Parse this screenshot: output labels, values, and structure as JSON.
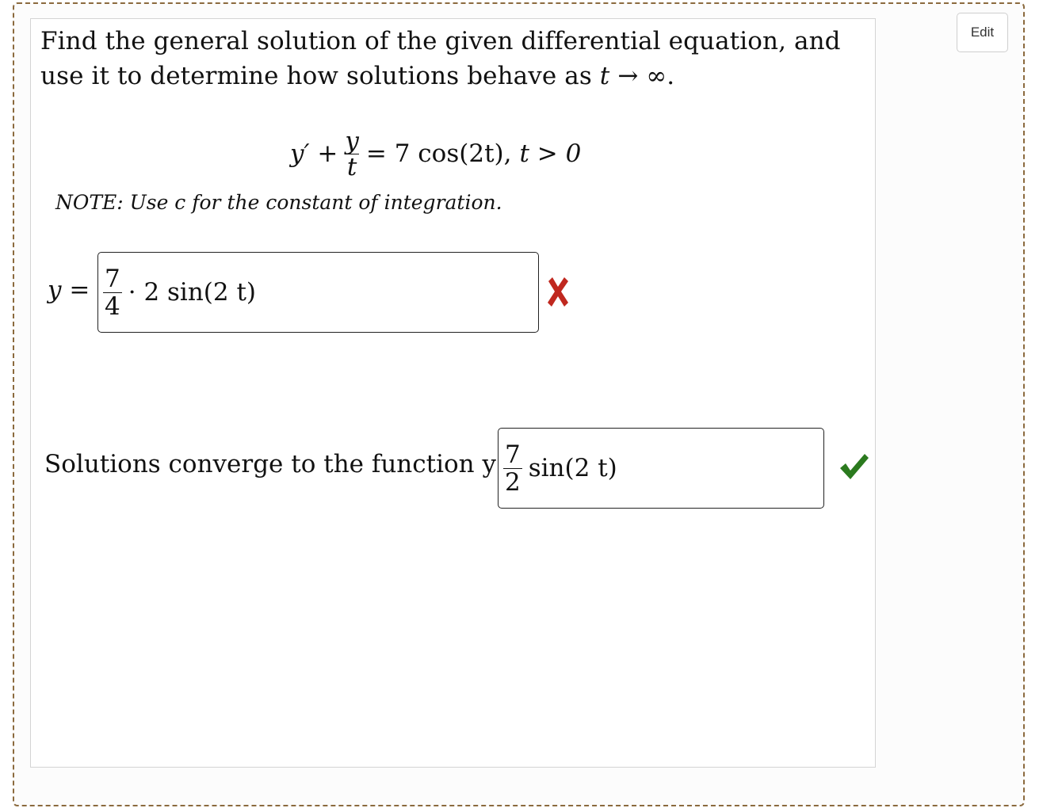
{
  "toolbar": {
    "edit_label": "Edit"
  },
  "question": {
    "prompt_part1": "Find the general solution of the given differential equation, and use it to determine how solutions behave as ",
    "prompt_var": "t",
    "prompt_arrow": " → ∞.",
    "equation": {
      "lhs_prime": "y′ +",
      "frac_num": "y",
      "frac_den": "t",
      "rhs": "= 7 cos(2t),",
      "cond": "t > 0"
    },
    "note": "NOTE: Use c for the constant of integration."
  },
  "answer1": {
    "label": "y =",
    "frac_num": "7",
    "frac_den": "4",
    "rest": "· 2 sin(2 t)",
    "status": "incorrect",
    "status_color": "#c0281f"
  },
  "answer2": {
    "label": "Solutions converge to the function y =",
    "frac_num": "7",
    "frac_den": "2",
    "rest": "sin(2 t)",
    "status": "correct",
    "status_color": "#2b7a1e"
  }
}
